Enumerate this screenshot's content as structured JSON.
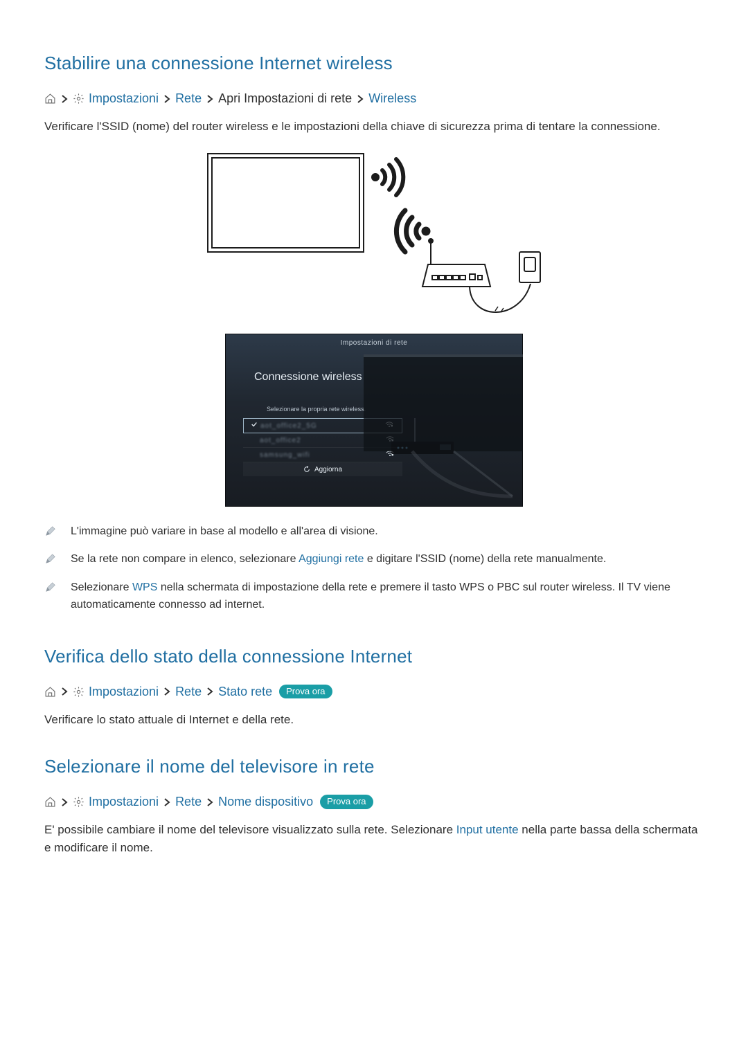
{
  "section1": {
    "title": "Stabilire una connessione Internet wireless",
    "path": {
      "impostazioni": "Impostazioni",
      "rete": "Rete",
      "apri": "Apri Impostazioni di rete",
      "wireless": "Wireless"
    },
    "body": "Verificare l'SSID (nome) del router wireless e le impostazioni della chiave di sicurezza prima di tentare la connessione."
  },
  "tv_ui": {
    "topbar": "Impostazioni di rete",
    "heading": "Connessione wireless",
    "sublabel": "Selezionare la propria rete wireless.",
    "rows": [
      {
        "ssid": "aot_office2_5G",
        "selected": true
      },
      {
        "ssid": "aot_office2",
        "selected": false
      },
      {
        "ssid": "samsung_wifi",
        "selected": false
      }
    ],
    "refresh": "Aggiorna"
  },
  "notes": {
    "n1": "L'immagine può variare in base al modello e all'area di visione.",
    "n2_pre": "Se la rete non compare in elenco, selezionare ",
    "n2_link": "Aggiungi rete",
    "n2_post": " e digitare l'SSID (nome) della rete manualmente.",
    "n3_pre": "Selezionare ",
    "n3_link": "WPS",
    "n3_post": " nella schermata di impostazione della rete e premere il tasto WPS o PBC sul router wireless. Il TV viene automaticamente connesso ad internet."
  },
  "section2": {
    "title": "Verifica dello stato della connessione Internet",
    "path": {
      "impostazioni": "Impostazioni",
      "rete": "Rete",
      "stato": "Stato rete"
    },
    "try": "Prova ora",
    "body": "Verificare lo stato attuale di Internet e della rete."
  },
  "section3": {
    "title": "Selezionare il nome del televisore in rete",
    "path": {
      "impostazioni": "Impostazioni",
      "rete": "Rete",
      "device": "Nome dispositivo"
    },
    "try": "Prova ora",
    "body_pre": "E' possibile cambiare il nome del televisore visualizzato sulla rete. Selezionare ",
    "body_link": "Input utente",
    "body_post": " nella parte bassa della schermata e modificare il nome."
  }
}
